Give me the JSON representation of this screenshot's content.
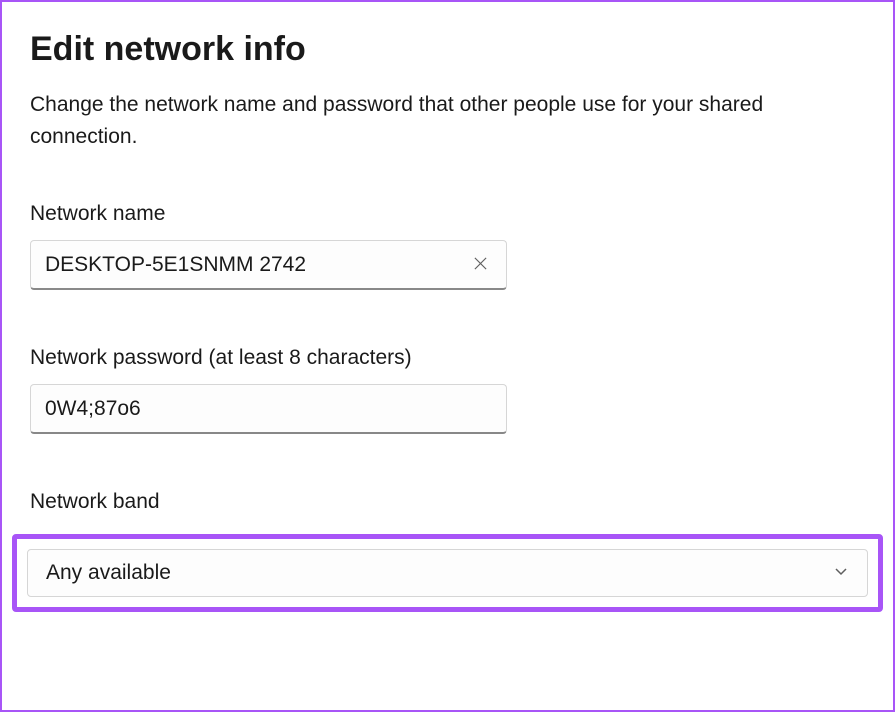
{
  "title": "Edit network info",
  "description": "Change the network name and password that other people use for your shared connection.",
  "fields": {
    "networkName": {
      "label": "Network name",
      "value": "DESKTOP-5E1SNMM 2742"
    },
    "networkPassword": {
      "label": "Network password (at least 8 characters)",
      "value": "0W4;87o6"
    },
    "networkBand": {
      "label": "Network band",
      "value": "Any available"
    }
  }
}
